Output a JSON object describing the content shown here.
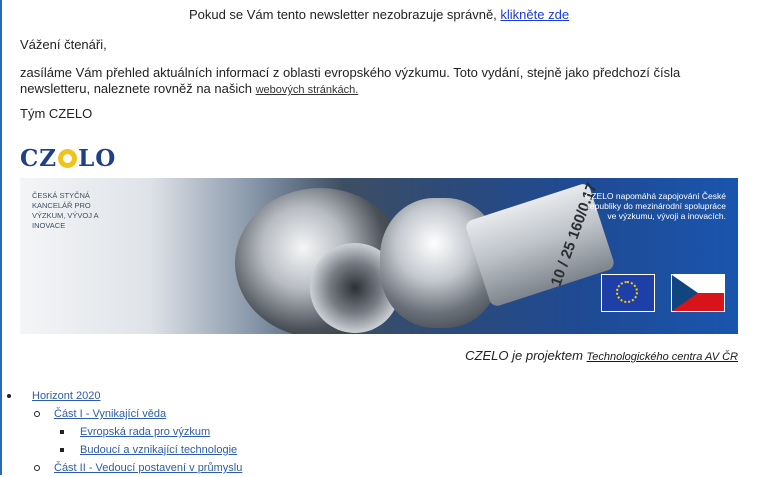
{
  "header": {
    "notice_text": "Pokud se Vám tento newsletter nezobrazuje správně,",
    "notice_link": "klikněte zde"
  },
  "letter": {
    "greeting": "Vážení čtenáři,",
    "intro_text": "zasíláme Vám přehled aktuálních informací z oblasti evropského výzkumu. Toto vydání, stejně jako předchozí čísla newsletteru, naleznete rovněž na našich",
    "intro_link": "webových stránkách.",
    "signature": "Tým CZELO"
  },
  "logo": {
    "text_left": "CZ",
    "text_right": "LO"
  },
  "banner": {
    "caption": "ČESKÁ STYČNÁ KANCELÁŘ PRO VÝZKUM, VÝVOJ A INOVACE",
    "tagline": "CZELO napomáhá zapojování České republiky do mezinárodní spolupráce ve výzkumu, vývoji a inovacích.",
    "barrel_text": "10 / 25 160/0.17",
    "accent_color": "#1a55ad"
  },
  "project": {
    "text": "CZELO je projektem",
    "link": "Technologického centra AV ČR"
  },
  "toc": [
    {
      "level": 1,
      "label": "Horizont 2020"
    },
    {
      "level": 2,
      "label": "Část I - Vynikající věda"
    },
    {
      "level": 3,
      "label": "Evropská rada pro výzkum"
    },
    {
      "level": 3,
      "label": "Budoucí a vznikající technologie"
    },
    {
      "level": 2,
      "label": "Část II - Vedoucí postavení v průmyslu"
    }
  ]
}
